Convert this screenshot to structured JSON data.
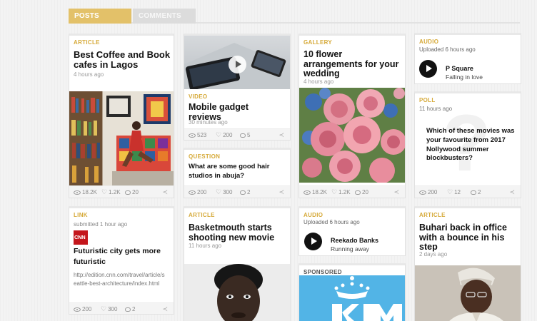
{
  "tabs": {
    "posts": "POSTS",
    "comments": "COMMENTS"
  },
  "cards": {
    "coffee": {
      "label": "ARTICLE",
      "title": "Best Coffee and Book cafes in Lagos",
      "time": "4 hours ago",
      "views": "18.2K",
      "likes": "1.2K",
      "comments": "20"
    },
    "gadget": {
      "label": "VIDEO",
      "title": "Mobile gadget reviews",
      "time": "30 minutes ago",
      "views": "523",
      "likes": "200",
      "comments": "5"
    },
    "hair": {
      "label": "QUESTION",
      "title": "What are some good hair studios in abuja?",
      "views": "200",
      "likes": "300",
      "comments": "2"
    },
    "flower": {
      "label": "GALLERY",
      "title": "10 flower arrangements for your wedding",
      "time": "4 hours ago",
      "views": "18.2K",
      "likes": "1.2K",
      "comments": "20"
    },
    "psquare": {
      "label": "AUDIO",
      "uploaded": "Uploaded 6 hours ago",
      "artist": "P Square",
      "track": "Falling in love"
    },
    "poll": {
      "label": "POLL",
      "time": "11 hours ago",
      "question": "Which of these movies was your favourite from 2017 Nollywood summer blockbusters?",
      "views": "200",
      "likes": "12",
      "comments": "2"
    },
    "link": {
      "label": "LINK",
      "submitted": "submitted 1 hour ago",
      "source": "CNN",
      "title": "Futuristic city gets more futuristic",
      "url": "http://edition.cnn.com/travel/article/seattle-best-architecture/index.html",
      "views": "200",
      "likes": "300",
      "comments": "2"
    },
    "basket": {
      "label": "ARTICLE",
      "title": "Basketmouth starts shooting new movie",
      "time": "11 hours ago"
    },
    "reekado": {
      "label": "AUDIO",
      "uploaded": "Uploaded 6 hours ago",
      "artist": "Reekado Banks",
      "track": "Running away"
    },
    "sponsored": {
      "label": "SPONSORED",
      "brand": "KLM"
    },
    "buhari": {
      "label": "ARTICLE",
      "title": "Buhari back in office with a bounce in his step",
      "time": "2 days ago"
    }
  },
  "colors": {
    "accent": "#d6aa3a",
    "tab_active": "#e3c169",
    "klm_blue": "#4fb3e6"
  }
}
